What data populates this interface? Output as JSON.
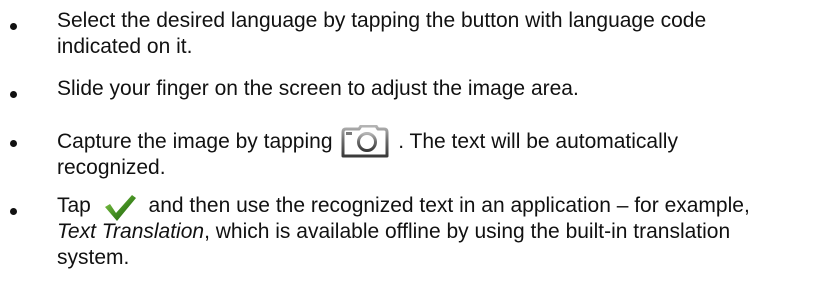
{
  "instructions": {
    "item1": {
      "line1": "Select the desired language by tapping the button with language code",
      "line2": "indicated on it."
    },
    "item2": {
      "line1": "Slide your finger on the screen to adjust the image area."
    },
    "item3": {
      "before_icon": "Capture the image by tapping",
      "after_icon": ". The text will be automatically",
      "line2": "recognized.",
      "icon": "camera-icon"
    },
    "item4": {
      "before_icon": "Tap",
      "after_icon": "and then use the recognized text in an application – for example,",
      "app_name": "Text Translation",
      "line2_rest": ", which is available offline by using the built-in translation",
      "line3": "system.",
      "icon": "checkmark-icon",
      "icon_color": "#3f8a1f"
    }
  }
}
